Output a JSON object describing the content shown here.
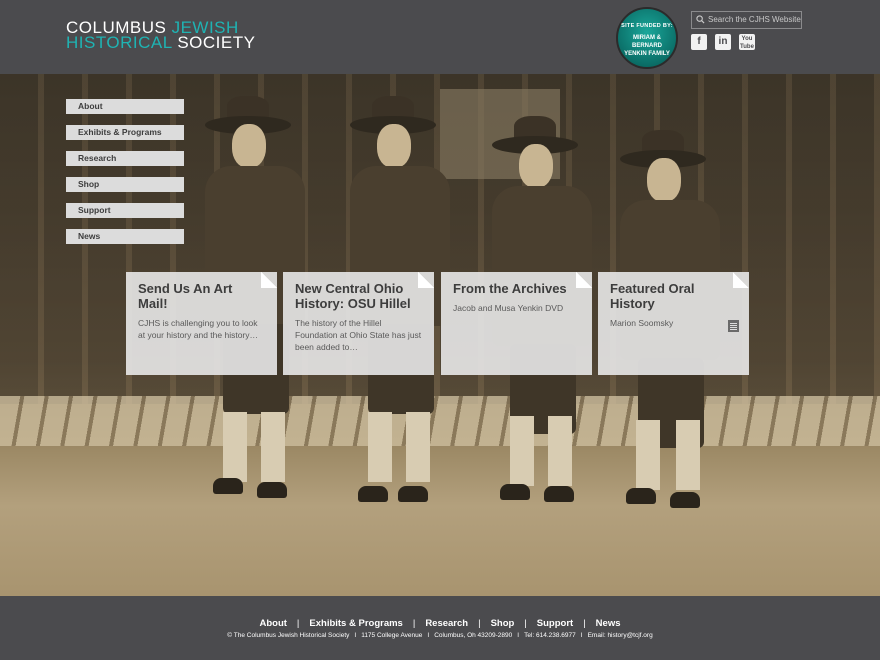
{
  "header": {
    "logo_line1_white": "COLUMBUS ",
    "logo_line1_teal": "JEWISH",
    "logo_line2_teal": "HISTORICAL ",
    "logo_line2_white": "SOCIETY",
    "badge": {
      "line1": "SITE FUNDED BY:",
      "line2": "MIRIAM & BERNARD",
      "line3": "YENKIN FAMILY"
    },
    "search_placeholder": "Search the CJHS Website",
    "socials": [
      "f",
      "in",
      "You Tube"
    ]
  },
  "nav": {
    "items": [
      "About",
      "Exhibits & Programs",
      "Research",
      "Shop",
      "Support",
      "News"
    ]
  },
  "cards": [
    {
      "title": "Send Us An Art Mail!",
      "text": "CJHS is challenging you to look at your history and the history…"
    },
    {
      "title": "New Central Ohio History: OSU Hillel",
      "text": "The history of the Hillel Foundation at Ohio State has just been added to…"
    },
    {
      "title": "From the Archives",
      "text": "Jacob and Musa Yenkin DVD"
    },
    {
      "title": "Featured Oral History",
      "text": "Marion Soomsky"
    }
  ],
  "footer": {
    "nav": [
      "About",
      "Exhibits & Programs",
      "Research",
      "Shop",
      "Support",
      "News"
    ],
    "nav_separator": "|",
    "info": [
      "© The Columbus Jewish Historical Society",
      "1175 College Avenue",
      "Columbus, Oh 43209-2890",
      "Tel: 614.238.6977",
      "Email: history@tcjf.org"
    ],
    "info_separator": "I"
  },
  "colors": {
    "header_bg": "#4b4b4e",
    "teal_accent": "#1fb3b3",
    "nav_bg": "#dcdcdc"
  }
}
